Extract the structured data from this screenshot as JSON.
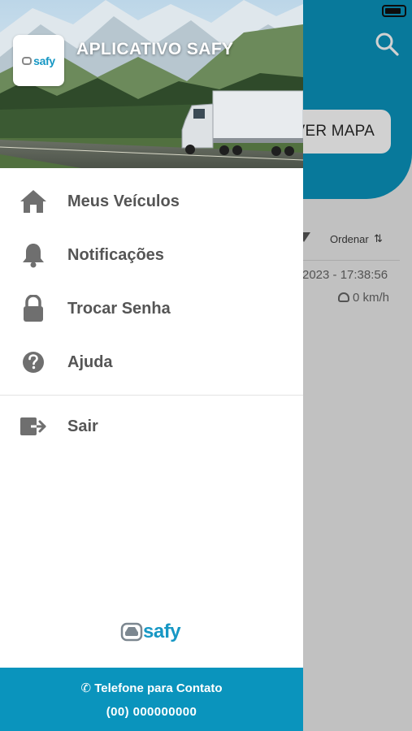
{
  "app": {
    "title": "APLICATIVO SAFY",
    "logo_text": "safy"
  },
  "background": {
    "map_button_label": "VER MAPA",
    "order_label": "Ordenar",
    "last_update": "2023 - 17:38:56",
    "speed": "0 km/h",
    "header_color": "#0a94bd"
  },
  "menu": {
    "items": [
      {
        "label": "Meus Veículos",
        "icon": "home-icon"
      },
      {
        "label": "Notificações",
        "icon": "bell-icon"
      },
      {
        "label": "Trocar Senha",
        "icon": "lock-icon"
      },
      {
        "label": "Ajuda",
        "icon": "help-icon"
      }
    ],
    "exit": {
      "label": "Sair",
      "icon": "logout-icon"
    }
  },
  "footer": {
    "logo_text": "safy",
    "contact_label": "Telefone para Contato",
    "contact_phone": "(00) 000000000",
    "bar_color": "#0a94bd"
  }
}
